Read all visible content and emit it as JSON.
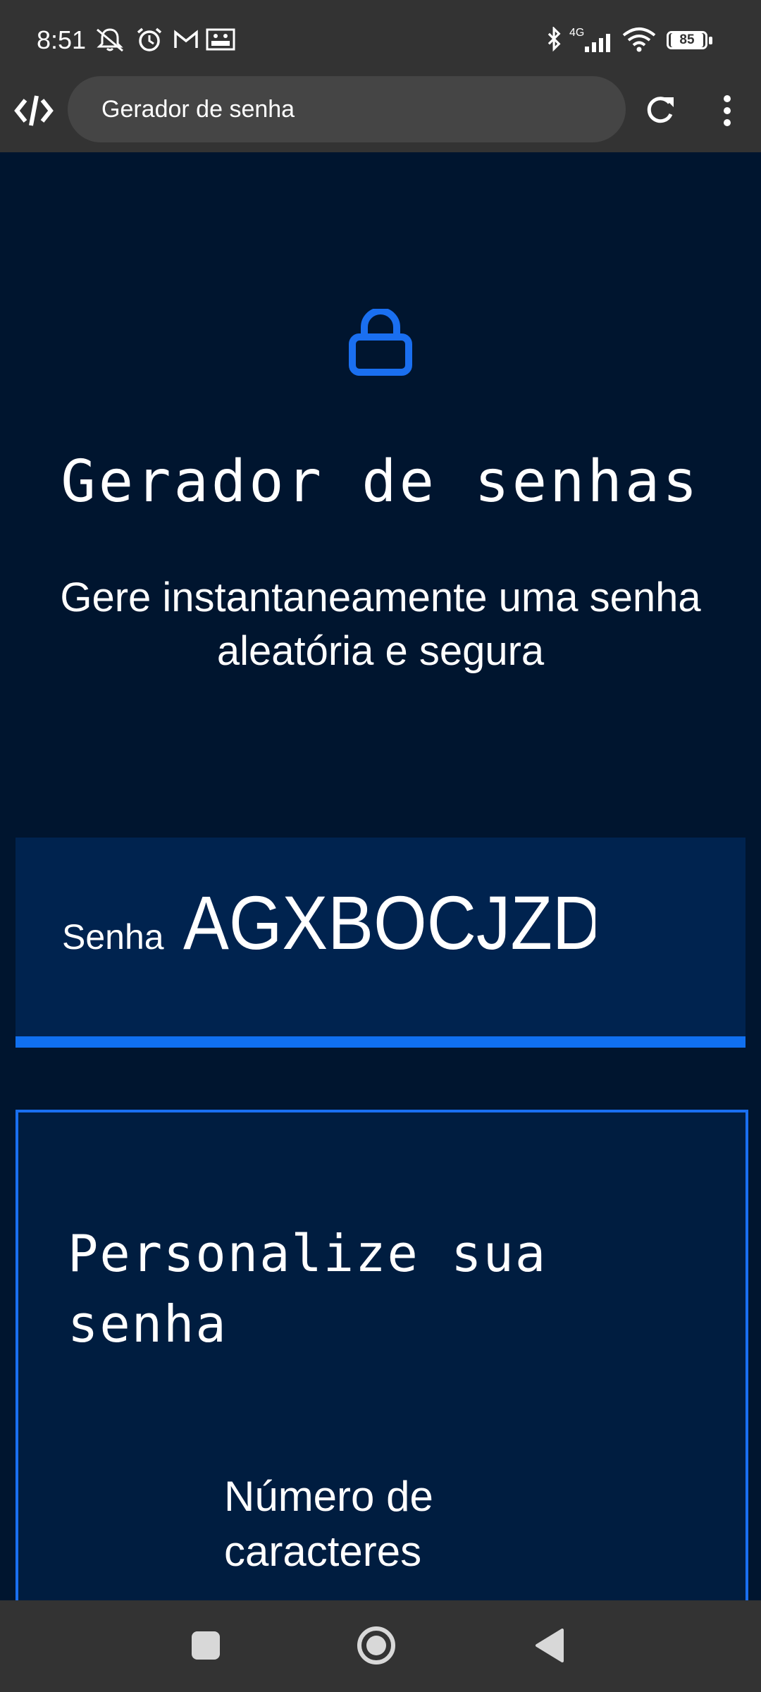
{
  "status_bar": {
    "time": "8:51",
    "icons_left": [
      "mute-icon",
      "alarm-icon",
      "gmail-icon",
      "gallery-icon"
    ],
    "icons_right": [
      "bluetooth-icon",
      "signal-4g-icon",
      "wifi-icon",
      "battery-icon"
    ],
    "network_label": "4G",
    "battery": "85"
  },
  "browser": {
    "url_text": "Gerador de senha"
  },
  "page": {
    "title": "Gerador de senhas",
    "subtitle": "Gere instantaneamente uma senha aleatória e segura",
    "password_label": "Senha",
    "password_value": "AGXBOCJZDZ",
    "customize_title": "Personalize sua senha",
    "char_count_label": "Número de caracteres"
  },
  "colors": {
    "background": "#00152f",
    "accent": "#1070f0",
    "bar": "#333333"
  }
}
